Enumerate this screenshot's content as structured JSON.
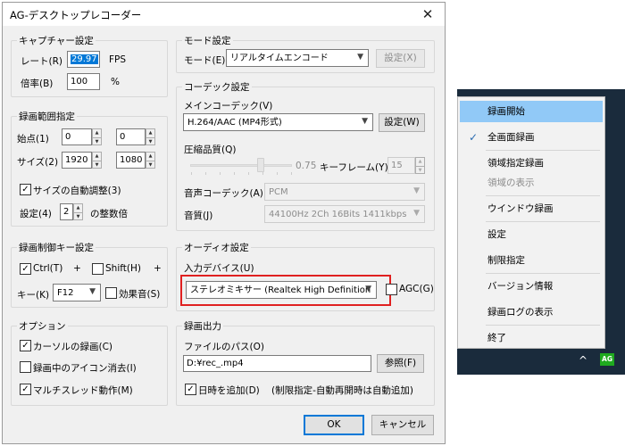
{
  "window": {
    "title": "AG-デスクトップレコーダー",
    "close": "✕"
  },
  "capture": {
    "title": "キャプチャー設定",
    "rate_label": "レート(R)",
    "rate_value": "29.97",
    "rate_unit": "FPS",
    "scale_label": "倍率(B)",
    "scale_value": "100",
    "scale_unit": "%"
  },
  "area": {
    "title": "録画範囲指定",
    "start_label": "始点(1)",
    "start_x": "0",
    "start_y": "0",
    "size_label": "サイズ(2)",
    "size_w": "1920",
    "size_h": "1080",
    "auto_adjust_label": "サイズの自動調整(3)",
    "auto_adjust_checked": true,
    "setting_label": "設定(4)",
    "setting_value": "2",
    "multiple_label": "の整数倍"
  },
  "hotkey": {
    "title": "録画制御キー設定",
    "ctrl_label": "Ctrl(T)",
    "ctrl_checked": true,
    "plus1": "+",
    "shift_label": "Shift(H)",
    "shift_checked": false,
    "plus2": "+",
    "key_label": "キー(K)",
    "key_value": "F12",
    "sound_label": "効果音(S)",
    "sound_checked": false
  },
  "options": {
    "title": "オプション",
    "cursor_label": "カーソルの録画(C)",
    "cursor_checked": true,
    "hide_icon_label": "録画中のアイコン消去(I)",
    "hide_icon_checked": false,
    "multithread_label": "マルチスレッド動作(M)",
    "multithread_checked": true
  },
  "mode": {
    "title": "モード設定",
    "mode_label": "モード(E)",
    "mode_value": "リアルタイムエンコード",
    "mode_button": "設定(X)"
  },
  "codec": {
    "title": "コーデック設定",
    "main_label": "メインコーデック(V)",
    "main_value": "H.264/AAC (MP4形式)",
    "main_button": "設定(W)",
    "quality_label": "圧縮品質(Q)",
    "quality_value": "0.75",
    "quality_level": 0.75,
    "keyframe_label": "キーフレーム(Y)",
    "keyframe_value": "15",
    "audio_codec_label": "音声コーデック(A)",
    "audio_codec_value": "PCM",
    "audio_quality_label": "音質(J)",
    "audio_quality_value": "44100Hz 2Ch 16Bits 1411kbps"
  },
  "audio": {
    "title": "オーディオ設定",
    "input_label": "入力デバイス(U)",
    "input_value": "ステレオミキサー (Realtek High Definition",
    "agc_label": "AGC(G)",
    "agc_checked": false
  },
  "output": {
    "title": "録画出力",
    "path_label": "ファイルのパス(O)",
    "path_value": "D:¥rec_.mp4",
    "browse_button": "参照(F)",
    "date_label": "日時を追加(D)",
    "date_checked": true,
    "date_note": "(制限指定-自動再開時は自動追加)"
  },
  "buttons": {
    "ok": "OK",
    "cancel": "キャンセル"
  },
  "tray_menu": {
    "items": [
      "録画開始",
      "全画面録画",
      "領域指定録画",
      "領域の表示",
      "ウインドウ録画",
      "設定",
      "制限指定",
      "バージョン情報",
      "録画ログの表示",
      "終了"
    ],
    "check": "✓"
  },
  "taskbar": {
    "caret": "^",
    "app_icon": "AG"
  },
  "colors": {
    "highlight": "#0078d7",
    "menu_hover": "#91c9f7",
    "annotation": "#e02020",
    "taskbar": "#1a2b3c",
    "tray_icon": "#1faa1f"
  }
}
